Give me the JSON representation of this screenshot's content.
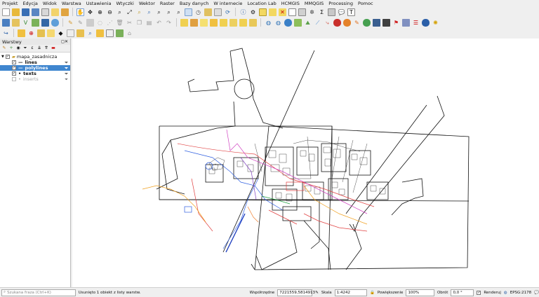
{
  "menu": [
    "Projekt",
    "Edycja",
    "Widok",
    "Warstwa",
    "Ustawienia",
    "Wtyczki",
    "Wektor",
    "Raster",
    "Bazy danych",
    "W internecie",
    "Location Lab",
    "HCMGIS",
    "MMQGIS",
    "Processing",
    "Pomoc"
  ],
  "layers_panel": {
    "title": "Warstwy",
    "group": "mapa_zasadnicza",
    "layers": [
      {
        "name": "lines",
        "checked": true,
        "selected": false
      },
      {
        "name": "polylines",
        "checked": true,
        "selected": true
      },
      {
        "name": "texts",
        "checked": true,
        "selected": false
      },
      {
        "name": "inserts",
        "checked": false,
        "selected": false
      }
    ]
  },
  "status": {
    "search_placeholder": "Szukana fraza (Ctrl+K)",
    "message": "Usunięto 1 obiekt z listy warstw.",
    "coord_label": "Współrzędne",
    "coord_value": "7221559,5814913",
    "scale_label": "Skala",
    "scale_value": "1:4242",
    "zoom_label": "Powiększenie",
    "zoom_value": "100%",
    "rotation_label": "Obrót",
    "rotation_value": "0,0 °",
    "render_label": "Renderuj",
    "crs": "EPSG:2178"
  },
  "colors": {
    "selection": "#3f86cf",
    "toolbar_bg": "#efefef",
    "canvas_bg": "#ffffff"
  }
}
